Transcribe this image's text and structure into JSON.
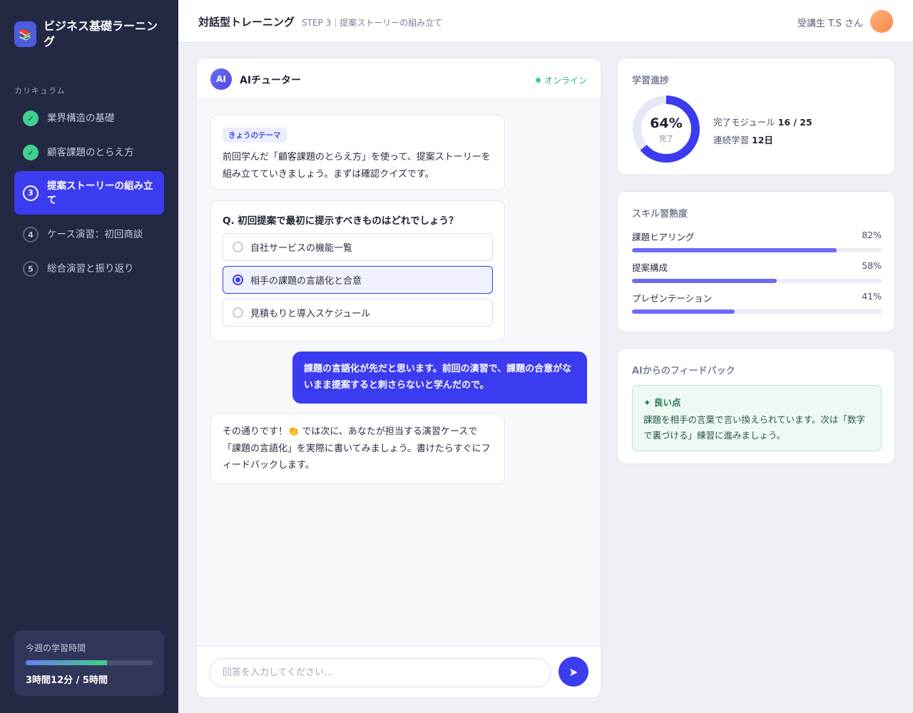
{
  "sidebar": {
    "brand_icon": "📚",
    "brand_title": "ビジネス基礎ラーニング",
    "nav_heading": "カリキュラム",
    "items": [
      {
        "status": "done",
        "badge": "✓",
        "label": "業界構造の基礎"
      },
      {
        "status": "done",
        "badge": "✓",
        "label": "顧客課題のとらえ方"
      },
      {
        "status": "active",
        "badge": "3",
        "label": "提案ストーリーの組み立て"
      },
      {
        "status": "todo",
        "badge": "4",
        "label": "ケース演習：初回商談"
      },
      {
        "status": "todo",
        "badge": "5",
        "label": "総合演習と振り返り"
      }
    ],
    "weekly": {
      "label": "今週の学習時間",
      "value": "3時間12分 / 5時間",
      "progress_fraction": 0.64
    }
  },
  "header": {
    "title": "対話型トレーニング",
    "step": "STEP 3｜提案ストーリーの組み立て",
    "user": "受講生 T.S さん"
  },
  "chat": {
    "avatar_text": "AI",
    "name": "AIチューター",
    "status": "オンライン",
    "intro": {
      "tag": "きょうのテーマ",
      "text": "前回学んだ「顧客課題のとらえ方」を使って、提案ストーリーを組み立てていきましょう。まずは確認クイズです。"
    },
    "quiz": {
      "question": "Q. 初回提案で最初に提示すべきものはどれでしょう？",
      "options": [
        {
          "label": "自社サービスの機能一覧",
          "selected": false
        },
        {
          "label": "相手の課題の言語化と合意",
          "selected": true
        },
        {
          "label": "見積もりと導入スケジュール",
          "selected": false
        }
      ]
    },
    "user_message": "課題の言語化が先だと思います。前回の演習で、課題の合意がないまま提案すると刺さらないと学んだので。",
    "ai_reply": "その通りです！👏 では次に、あなたが担当する演習ケースで「課題の言語化」を実際に書いてみましょう。書けたらすぐにフィードバックします。",
    "input_placeholder": "回答を入力してください…",
    "send_icon": "➤"
  },
  "progress": {
    "title": "学習進捗",
    "percent_label": "64%",
    "percent_value": 64,
    "sub": "完了",
    "modules_label": "完了モジュール",
    "modules_value": "16 / 25",
    "streak_label": "連続学習",
    "streak_value": "12日"
  },
  "skills": {
    "title": "スキル習熟度",
    "items": [
      {
        "name": "課題ヒアリング",
        "pct_label": "82%",
        "value": 82
      },
      {
        "name": "提案構成",
        "pct_label": "58%",
        "value": 58
      },
      {
        "name": "プレゼンテーション",
        "pct_label": "41%",
        "value": 41
      }
    ]
  },
  "feedback": {
    "title": "AIからのフィードバック",
    "heading": "✦ 良い点",
    "text": "課題を相手の言葉で言い換えられています。次は「数字で裏づける」練習に進みましょう。"
  },
  "colors": {
    "accent": "#3b3bf0",
    "success": "#3fcf8e",
    "sidebar_bg": "#232843"
  }
}
